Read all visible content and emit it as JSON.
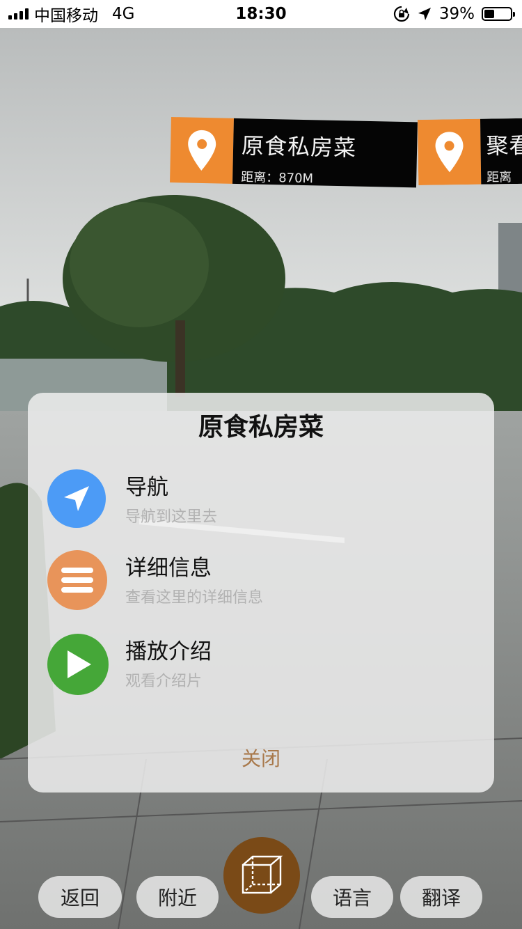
{
  "status_bar": {
    "carrier": "中国移动",
    "network": "4G",
    "time": "18:30",
    "battery_percent_text": "39%",
    "battery_level": 0.39
  },
  "ar_labels": [
    {
      "name": "原食私房菜",
      "distance": "距离：870M"
    },
    {
      "name": "聚看",
      "distance": "距离"
    }
  ],
  "panel": {
    "title": "原食私房菜",
    "items": [
      {
        "title": "导航",
        "subtitle": "导航到这里去",
        "icon": "navigation-arrow-icon",
        "color": "#4c9bf6"
      },
      {
        "title": "详细信息",
        "subtitle": "查看这里的详细信息",
        "icon": "list-menu-icon",
        "color": "#e8945a"
      },
      {
        "title": "播放介绍",
        "subtitle": "观看介绍片",
        "icon": "play-icon",
        "color": "#45a738"
      }
    ],
    "close_label": "关闭"
  },
  "toolbar": {
    "back": "返回",
    "nearby": "附近",
    "language": "语言",
    "translate": "翻译",
    "center_icon": "3d-cube-icon",
    "center_color": "#7a4a17"
  },
  "colors": {
    "poi_pin": "#ee8a30",
    "poi_body": "#050505",
    "close_text": "#a8784a"
  }
}
